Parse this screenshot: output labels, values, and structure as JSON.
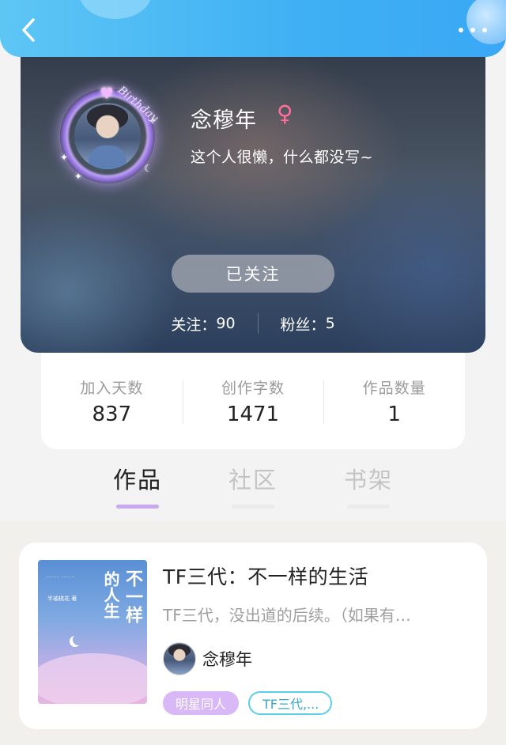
{
  "header": {
    "back_icon": "chevron-left-icon",
    "more_icon": "more-dots-icon",
    "color": "#3fb0f3"
  },
  "profile": {
    "username": "念穆年",
    "gender_symbol": "♀",
    "gender_color": "#ff6f9c",
    "bio": "这个人很懒，什么都没写~",
    "avatar_frame_text": "Birthday",
    "follow_button": "已关注",
    "following_label": "关注：",
    "following_count": "90",
    "followers_label": "粉丝：",
    "followers_count": "5"
  },
  "stats": [
    {
      "label": "加入天数",
      "value": "837"
    },
    {
      "label": "创作字数",
      "value": "1471"
    },
    {
      "label": "作品数量",
      "value": "1"
    }
  ],
  "tabs": [
    {
      "label": "作品",
      "active": true
    },
    {
      "label": "社区",
      "active": false
    },
    {
      "label": "书架",
      "active": false
    }
  ],
  "works": [
    {
      "title": "TF三代：不一样的生活",
      "description": "TF三代，没出道的后续。（如果有…",
      "author": "念穆年",
      "cover_title": "不一样",
      "cover_title2": "的人生",
      "cover_author": "半袖桃花 著",
      "tags": [
        "明星同人",
        "TF三代,..."
      ],
      "tag_colors": {
        "primary": "#d8b8f6",
        "outline": "#5ccfe6"
      }
    }
  ]
}
